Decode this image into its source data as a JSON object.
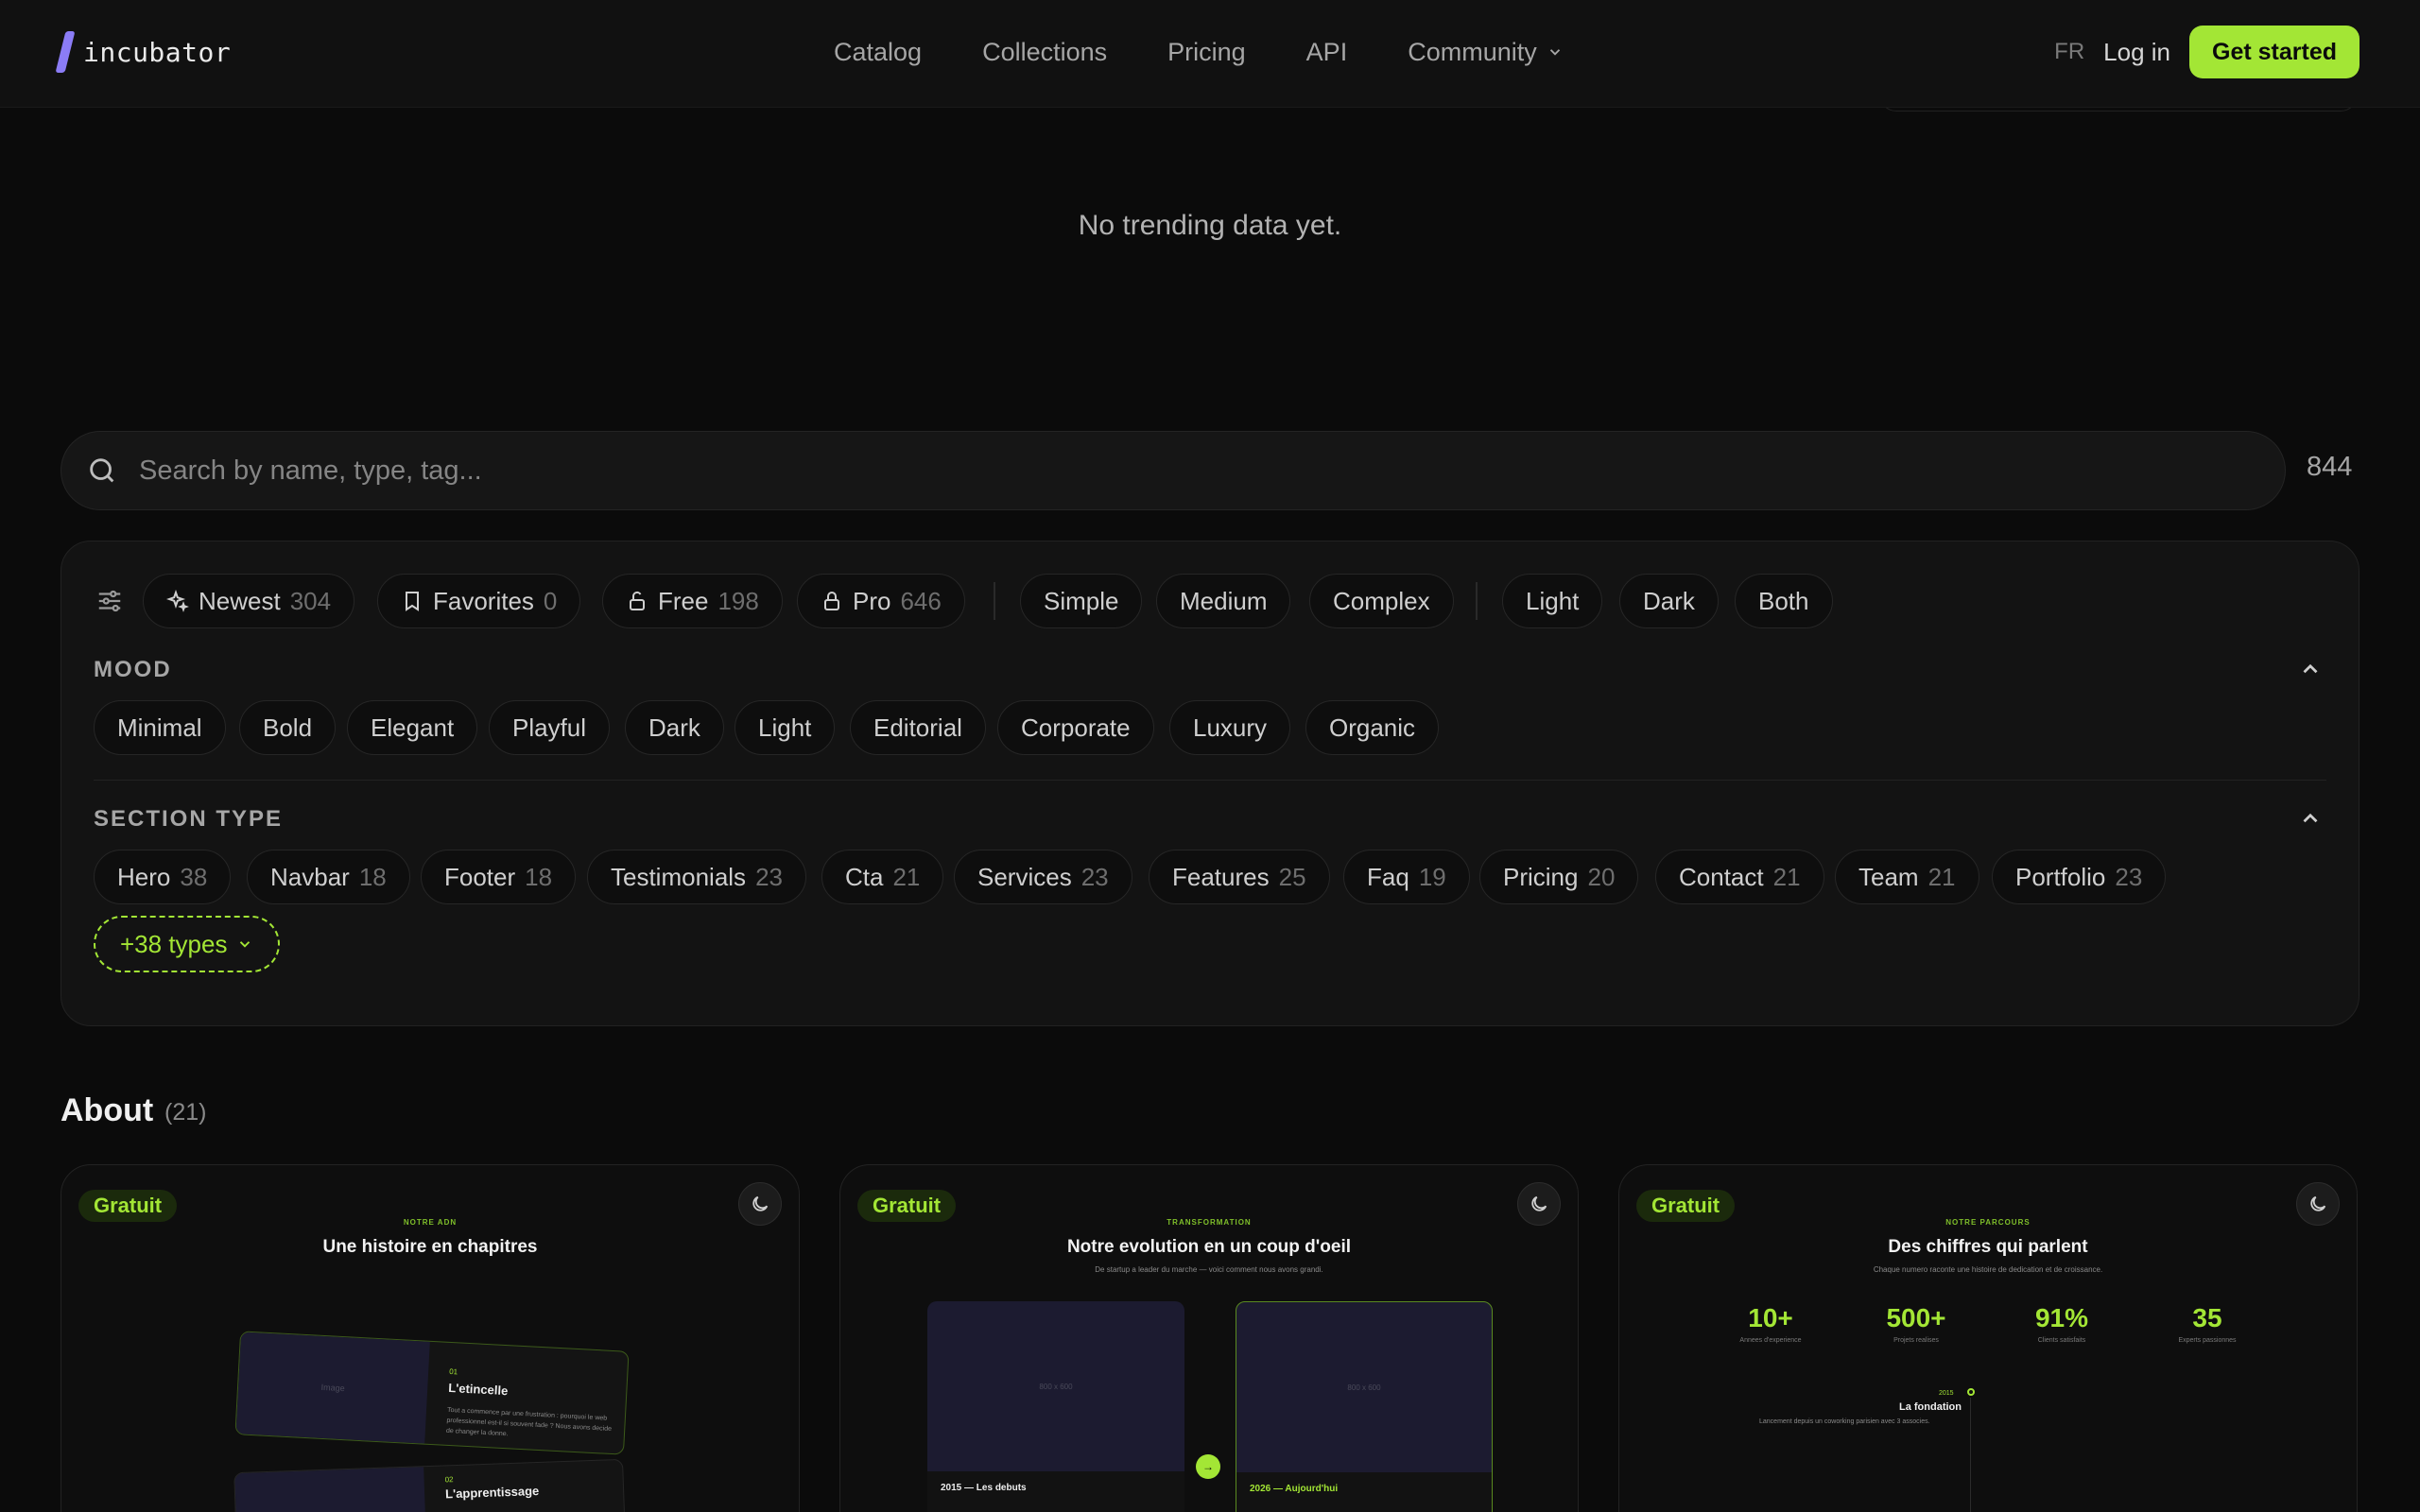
{
  "header": {
    "logo_text": "incubator",
    "nav": [
      "Catalog",
      "Collections",
      "Pricing",
      "API",
      "Community"
    ],
    "lang": "FR",
    "login": "Log in",
    "cta": "Get started"
  },
  "trending": {
    "empty_text": "No trending data yet."
  },
  "search": {
    "placeholder": "Search by name, type, tag...",
    "total": "844"
  },
  "filters": {
    "quick": [
      {
        "label": "Newest",
        "count": "304",
        "icon": "sparkles-icon"
      },
      {
        "label": "Favorites",
        "count": "0",
        "icon": "bookmark-icon"
      },
      {
        "label": "Free",
        "count": "198",
        "icon": "unlock-icon"
      },
      {
        "label": "Pro",
        "count": "646",
        "icon": "lock-icon"
      }
    ],
    "complexity": [
      "Simple",
      "Medium",
      "Complex"
    ],
    "theme": [
      "Light",
      "Dark",
      "Both"
    ],
    "mood": {
      "title": "MOOD",
      "items": [
        "Minimal",
        "Bold",
        "Elegant",
        "Playful",
        "Dark",
        "Light",
        "Editorial",
        "Corporate",
        "Luxury",
        "Organic"
      ]
    },
    "section_type": {
      "title": "SECTION TYPE",
      "items": [
        {
          "label": "Hero",
          "count": "38"
        },
        {
          "label": "Navbar",
          "count": "18"
        },
        {
          "label": "Footer",
          "count": "18"
        },
        {
          "label": "Testimonials",
          "count": "23"
        },
        {
          "label": "Cta",
          "count": "21"
        },
        {
          "label": "Services",
          "count": "23"
        },
        {
          "label": "Features",
          "count": "25"
        },
        {
          "label": "Faq",
          "count": "19"
        },
        {
          "label": "Pricing",
          "count": "20"
        },
        {
          "label": "Contact",
          "count": "21"
        },
        {
          "label": "Team",
          "count": "21"
        },
        {
          "label": "Portfolio",
          "count": "23"
        }
      ],
      "more": "+38 types"
    }
  },
  "about": {
    "title": "About",
    "count": "(21)",
    "cards": [
      {
        "badge": "Gratuit",
        "kicker": "NOTRE ADN",
        "title": "Une histoire en chapitres",
        "chapters": [
          {
            "num": "01",
            "title": "L'etincelle",
            "desc": "Tout a commence par une frustration : pourquoi le web professionnel est-il si souvent fade ? Nous avons decide de changer la donne.",
            "img": "Image"
          },
          {
            "num": "02",
            "title": "L'apprentissage",
            "img": ""
          }
        ]
      },
      {
        "badge": "Gratuit",
        "kicker": "TRANSFORMATION",
        "title": "Notre evolution en un coup d'oeil",
        "subtitle": "De startup a leader du marche — voici comment nous avons grandi.",
        "before": {
          "label": "2015 — Les debuts",
          "img": "800 x 600"
        },
        "after": {
          "label": "2026 — Aujourd'hui",
          "img": "800 x 600"
        }
      },
      {
        "badge": "Gratuit",
        "kicker": "NOTRE PARCOURS",
        "title": "Des chiffres qui parlent",
        "subtitle": "Chaque numero raconte une histoire de dedication et de croissance.",
        "stats": [
          {
            "value": "10+",
            "label": "Annees d'experience"
          },
          {
            "value": "500+",
            "label": "Projets realises"
          },
          {
            "value": "91%",
            "label": "Clients satisfaits"
          },
          {
            "value": "35",
            "label": "Experts passionnes"
          }
        ],
        "timeline": {
          "year": "2015",
          "title": "La fondation",
          "desc": "Lancement depuis un coworking parisien avec 3 associes."
        }
      }
    ]
  },
  "colors": {
    "accent": "#a3e635",
    "brand_mark": "#8b7cf6",
    "background": "#0b0b0b"
  }
}
